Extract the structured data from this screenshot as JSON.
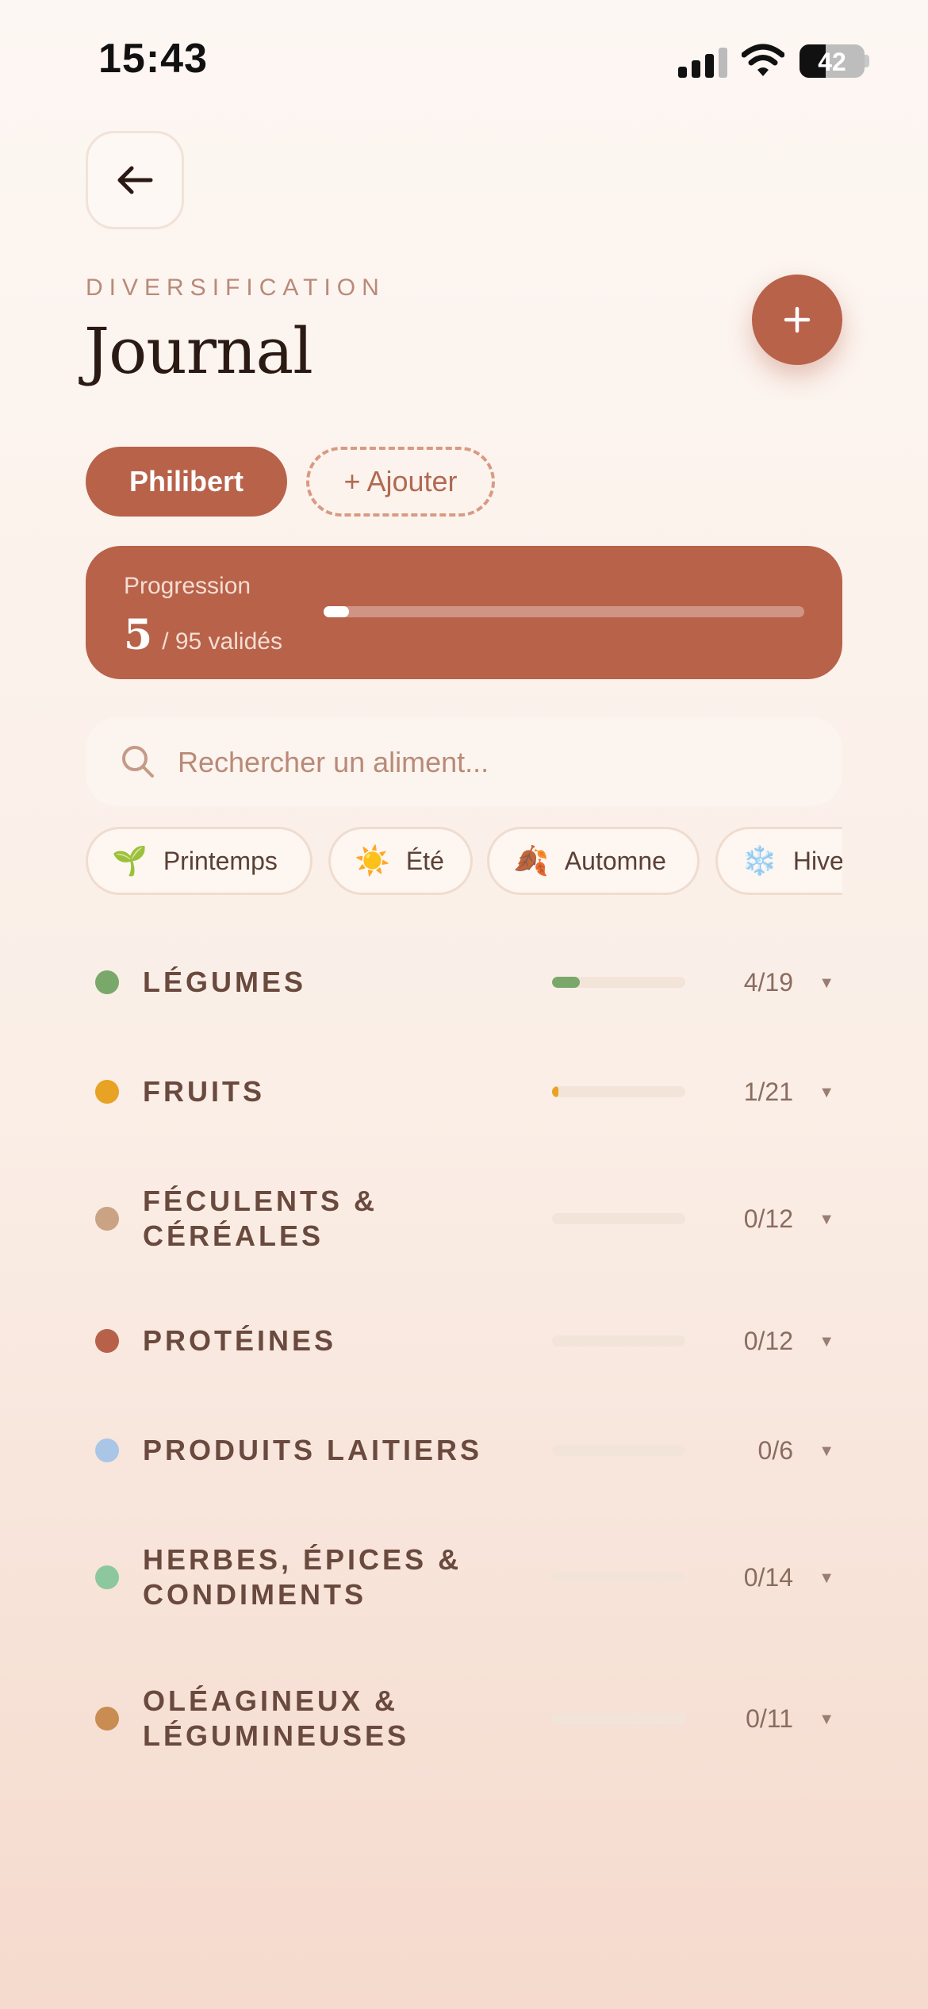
{
  "status_bar": {
    "time": "15:43",
    "battery": "42"
  },
  "header": {
    "overline": "DIVERSIFICATION",
    "title": "Journal"
  },
  "children": {
    "active": "Philibert",
    "add_label": "+ Ajouter"
  },
  "progression": {
    "label": "Progression",
    "validated": "5",
    "total_text": "/ 95 validés",
    "fraction": 0.053
  },
  "search": {
    "placeholder": "Rechercher un aliment..."
  },
  "seasons": [
    {
      "emoji": "🌱",
      "label": "Printemps"
    },
    {
      "emoji": "☀️",
      "label": "Été"
    },
    {
      "emoji": "🍂",
      "label": "Automne"
    },
    {
      "emoji": "❄️",
      "label": "Hiver"
    }
  ],
  "categories": [
    {
      "label": "LÉGUMES",
      "count": "4/19",
      "fraction": 0.21,
      "color": "#7aa86a"
    },
    {
      "label": "FRUITS",
      "count": "1/21",
      "fraction": 0.048,
      "color": "#e8a224"
    },
    {
      "label": "FÉCULENTS & CÉRÉALES",
      "count": "0/12",
      "fraction": 0,
      "color": "#c9a384"
    },
    {
      "label": "PROTÉINES",
      "count": "0/12",
      "fraction": 0,
      "color": "#b8614a"
    },
    {
      "label": "PRODUITS LAITIERS",
      "count": "0/6",
      "fraction": 0,
      "color": "#a9c6e6"
    },
    {
      "label": "HERBES, ÉPICES & CONDIMENTS",
      "count": "0/14",
      "fraction": 0,
      "color": "#8cc79e"
    },
    {
      "label": "OLÉAGINEUX & LÉGUMINEUSES",
      "count": "0/11",
      "fraction": 0,
      "color": "#c98c52"
    }
  ]
}
